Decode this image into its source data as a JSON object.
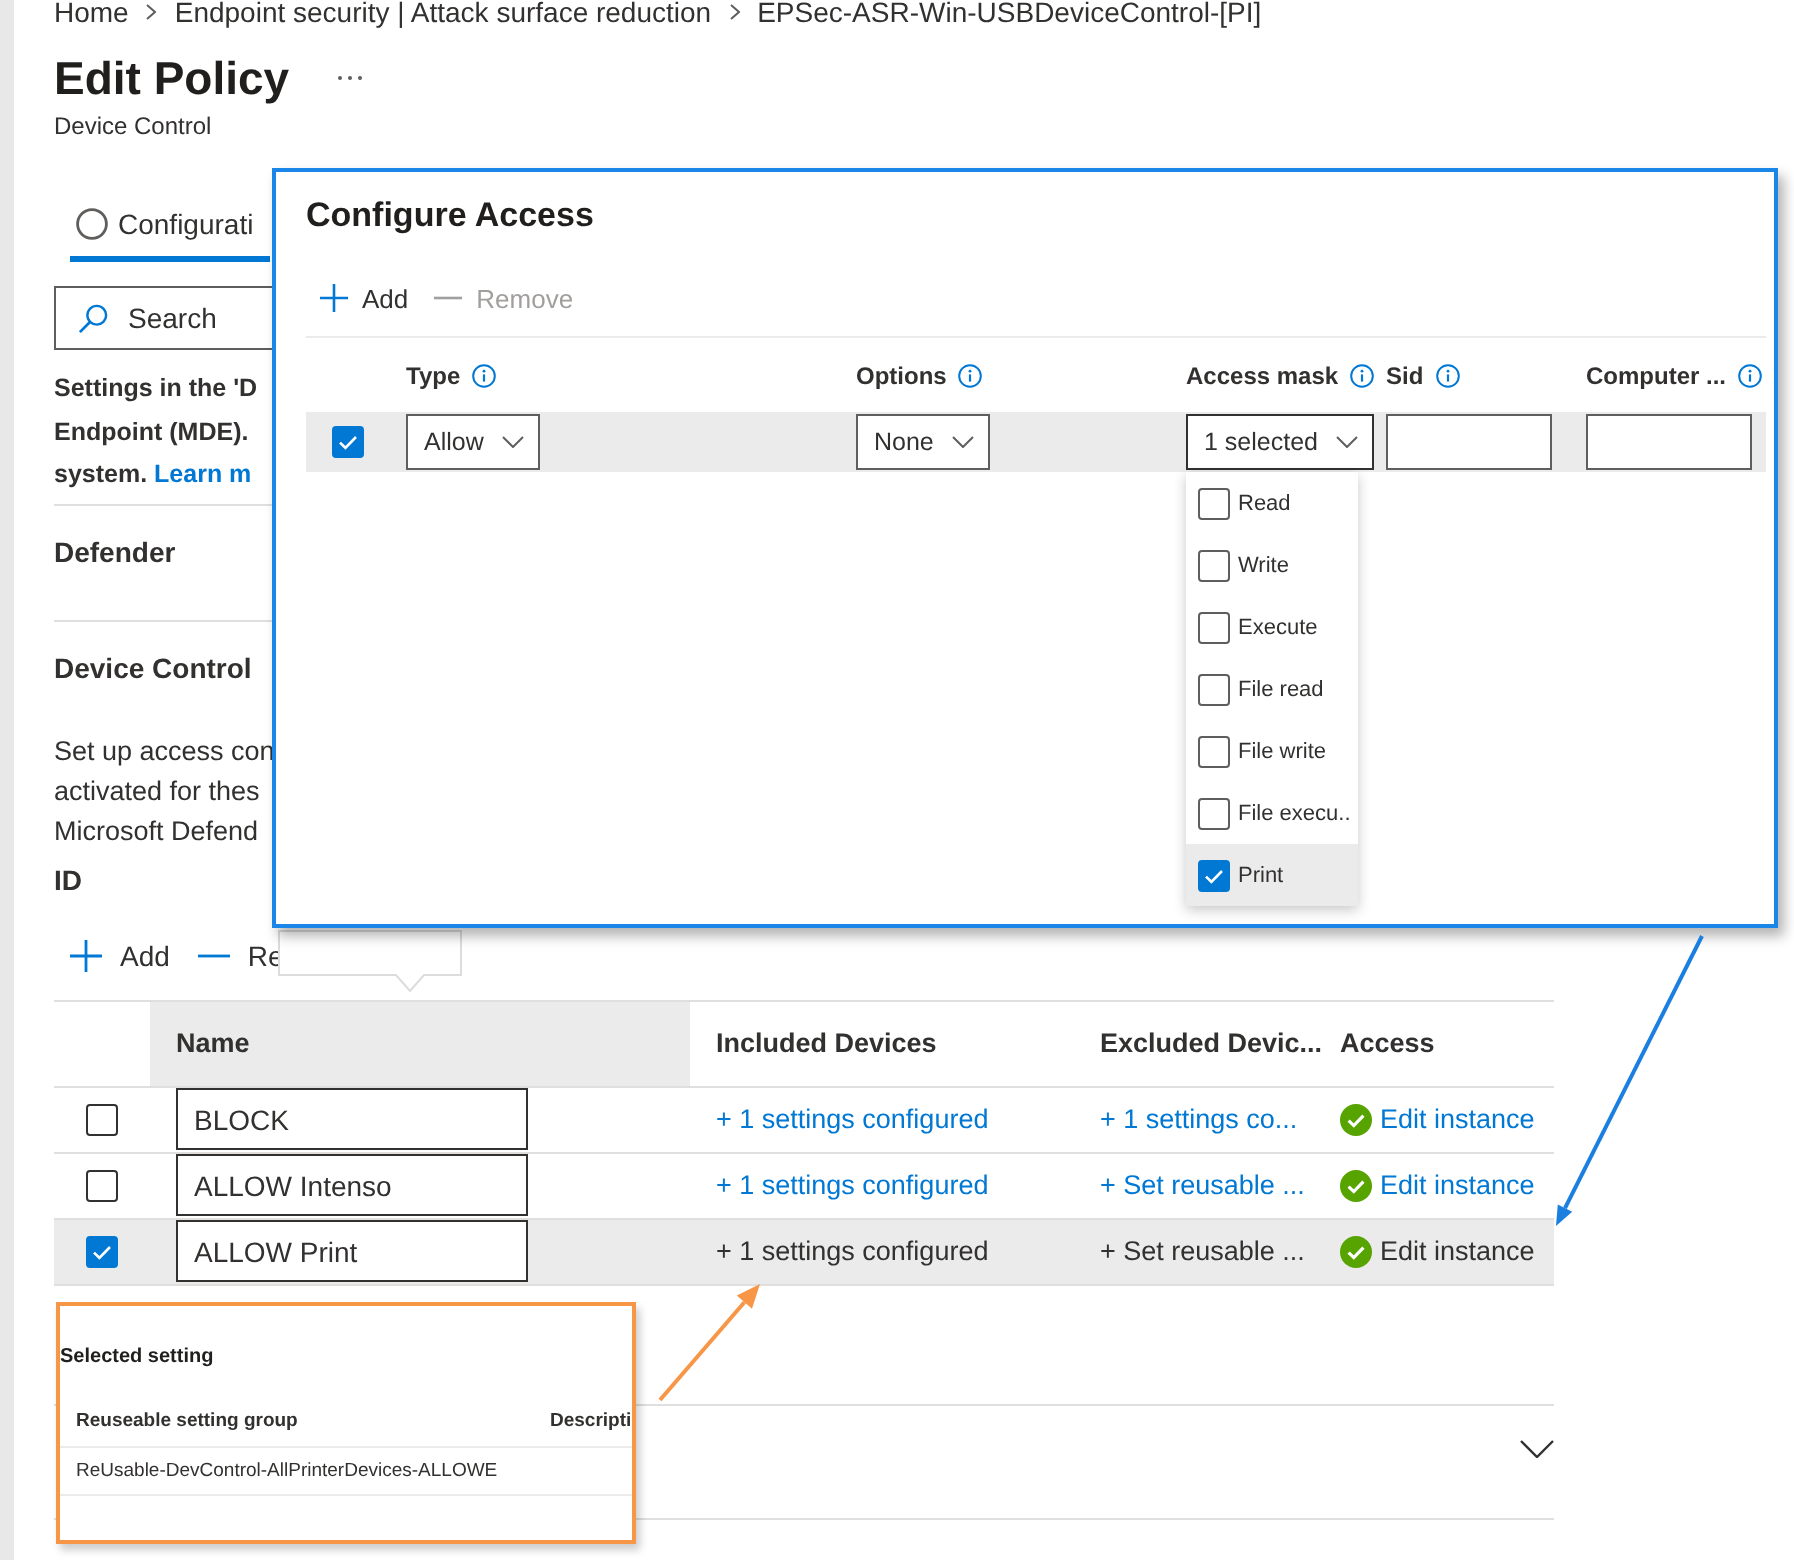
{
  "breadcrumb": [
    {
      "label": "Home"
    },
    {
      "label": "Endpoint security | Attack surface reduction"
    },
    {
      "label": "EPSec-ASR-Win-USBDeviceControl-[PI]"
    }
  ],
  "page": {
    "title": "Edit Policy",
    "subtitle": "Device Control"
  },
  "tabs": [
    {
      "label": "Configurati",
      "selected": true
    }
  ],
  "search": {
    "placeholder": "Search"
  },
  "intro": {
    "lines": [
      {
        "text": "Settings in the 'D"
      },
      {
        "text": "Endpoint (MDE)."
      },
      {
        "text": "system.",
        "link": "Learn m"
      }
    ]
  },
  "defender": {
    "title": "Defender"
  },
  "device_control": {
    "title": "Device Control",
    "description_lines": [
      "Set up access con",
      "activated for thes",
      "Microsoft Defend"
    ],
    "id_label": "ID",
    "toolbar": [
      {
        "kind": "add",
        "label": "Add",
        "disabled": false
      },
      {
        "kind": "remove",
        "label": "Re",
        "disabled": false
      }
    ],
    "table": {
      "columns": [
        {
          "label": "Name",
          "highlighted": true
        },
        {
          "label": "Included Devices",
          "highlighted": false
        },
        {
          "label": "Excluded Devic...",
          "highlighted": false
        },
        {
          "label": "Access",
          "highlighted": false
        }
      ],
      "rows": [
        {
          "selected": false,
          "name": "BLOCK",
          "included": "+ 1 settings configured",
          "excluded": "+ 1 settings co...",
          "access": "Edit instance"
        },
        {
          "selected": false,
          "name": "ALLOW Intenso",
          "included": "+ 1 settings configured",
          "excluded": "+ Set reusable ...",
          "access": "Edit instance"
        },
        {
          "selected": true,
          "name": "ALLOW Print",
          "included": "+ 1 settings configured",
          "excluded": "+ Set reusable ...",
          "access": "Edit instance"
        }
      ]
    }
  },
  "configure_access": {
    "title": "Configure Access",
    "toolbar": [
      {
        "kind": "add",
        "label": "Add",
        "disabled": false
      },
      {
        "kind": "remove",
        "label": "Remove",
        "disabled": true
      }
    ],
    "columns": [
      {
        "label": "Type",
        "kind": "dropdown"
      },
      {
        "label": "Options",
        "kind": "dropdown"
      },
      {
        "label": "Access mask",
        "kind": "dropdown",
        "menu": {
          "expanded": true,
          "items": [
            {
              "label": "Read",
              "checked": false,
              "highlighted": false
            },
            {
              "label": "Write",
              "checked": false,
              "highlighted": false
            },
            {
              "label": "Execute",
              "checked": false,
              "highlighted": false
            },
            {
              "label": "File read",
              "checked": false,
              "highlighted": false
            },
            {
              "label": "File write",
              "checked": false,
              "highlighted": false
            },
            {
              "label": "File execu..",
              "checked": false,
              "highlighted": false
            },
            {
              "label": "Print",
              "checked": true,
              "highlighted": true
            }
          ]
        }
      },
      {
        "label": "Sid",
        "kind": "text"
      },
      {
        "label": "Computer ...",
        "kind": "text"
      }
    ],
    "rows": [
      {
        "selected": true,
        "values": [
          "Allow",
          "None",
          "1 selected"
        ]
      }
    ]
  },
  "selected_setting": {
    "title": "Selected setting",
    "columns": [
      "Reuseable setting group",
      "Descripti"
    ],
    "rows": [
      [
        "ReUsable-DevControl-AllPrinterDevices-ALLOWE"
      ]
    ]
  }
}
